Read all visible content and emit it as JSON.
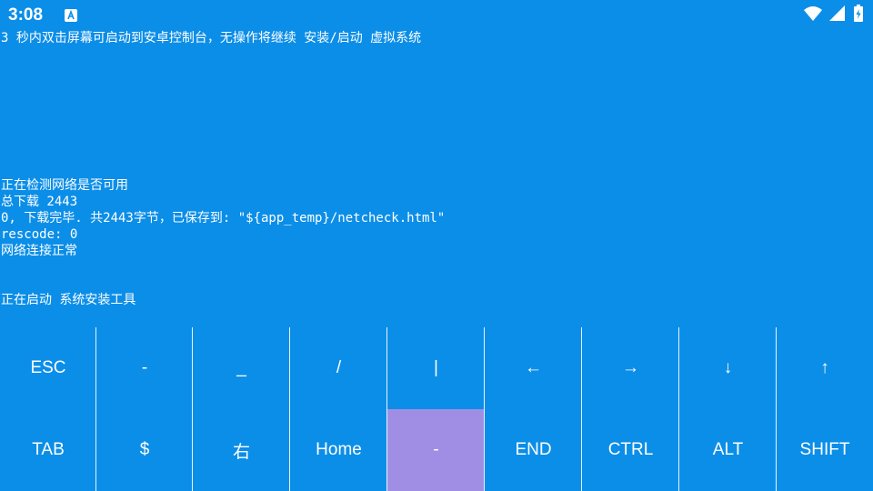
{
  "status_bar": {
    "time": "3:08",
    "app_icon": "app-notification-icon",
    "right_icons": [
      "wifi-icon",
      "cellular-signal-icon",
      "battery-icon"
    ]
  },
  "terminal": {
    "lines": [
      "3 秒内双击屏幕可启动到安卓控制台，无操作将继续 安装/启动 虚拟系统",
      "正在检测网络是否可用",
      "总下载 2443",
      "0, 下载完毕. 共2443字节，已保存到: \"${app_temp}/netcheck.html\"",
      "rescode: 0",
      "网络连接正常",
      "正在启动 系统安装工具"
    ]
  },
  "extra_keys": {
    "row1": [
      "ESC",
      "-",
      "_",
      "/",
      "|",
      "←",
      "→",
      "↓",
      "↑"
    ],
    "row2": [
      "TAB",
      "$",
      "右",
      "Home",
      "-",
      "END",
      "CTRL",
      "ALT",
      "SHIFT"
    ]
  },
  "colors": {
    "background": "#0b8ee8",
    "active_key": "#a08ee4",
    "text": "#ffffff"
  }
}
